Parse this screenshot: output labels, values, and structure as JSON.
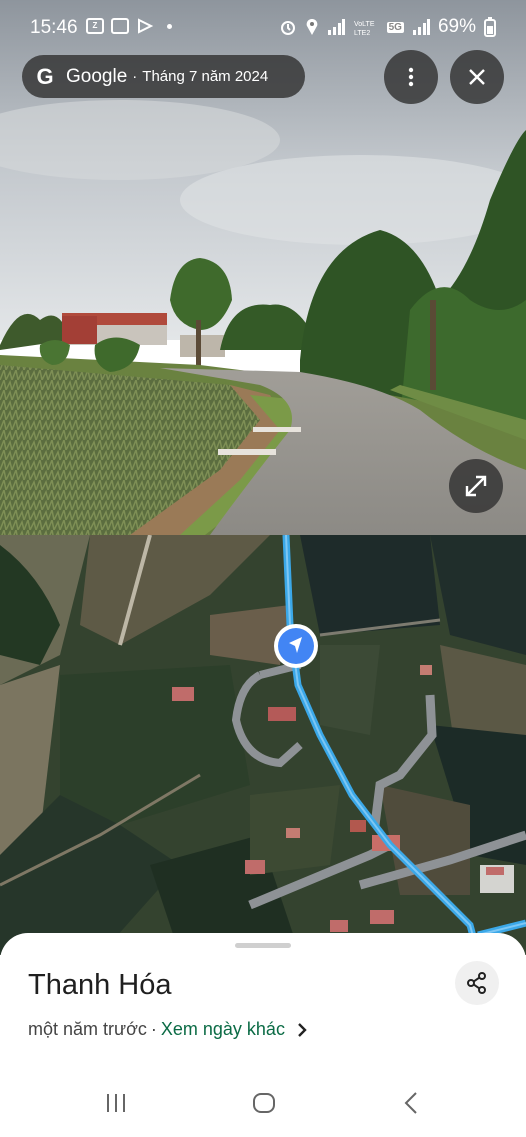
{
  "status_bar": {
    "time": "15:46",
    "left_icons": [
      "zalo-icon",
      "gallery-icon",
      "play-icon",
      "dot-icon"
    ],
    "right_icons": [
      "alarm-icon",
      "location-icon",
      "signal-icon",
      "volte-icon",
      "5g-icon",
      "signal-icon"
    ],
    "network_label": "5G",
    "battery": "69%"
  },
  "header": {
    "brand": "Google",
    "separator": "·",
    "date": "Tháng 7 năm 2024",
    "menu_icon": "more-vert-icon",
    "close_icon": "close-icon"
  },
  "street_view": {
    "expand_icon": "expand-icon"
  },
  "map": {
    "route_color": "#3ba8e8",
    "location_marker_color": "#4285f4"
  },
  "sheet": {
    "place_name": "Thanh Hóa",
    "time_ago": "một năm trước",
    "separator": "·",
    "other_dates_link": "Xem ngày khác",
    "share_icon": "share-icon"
  },
  "nav": {
    "recents_icon": "recents-icon",
    "home_icon": "home-icon",
    "back_icon": "back-icon"
  }
}
